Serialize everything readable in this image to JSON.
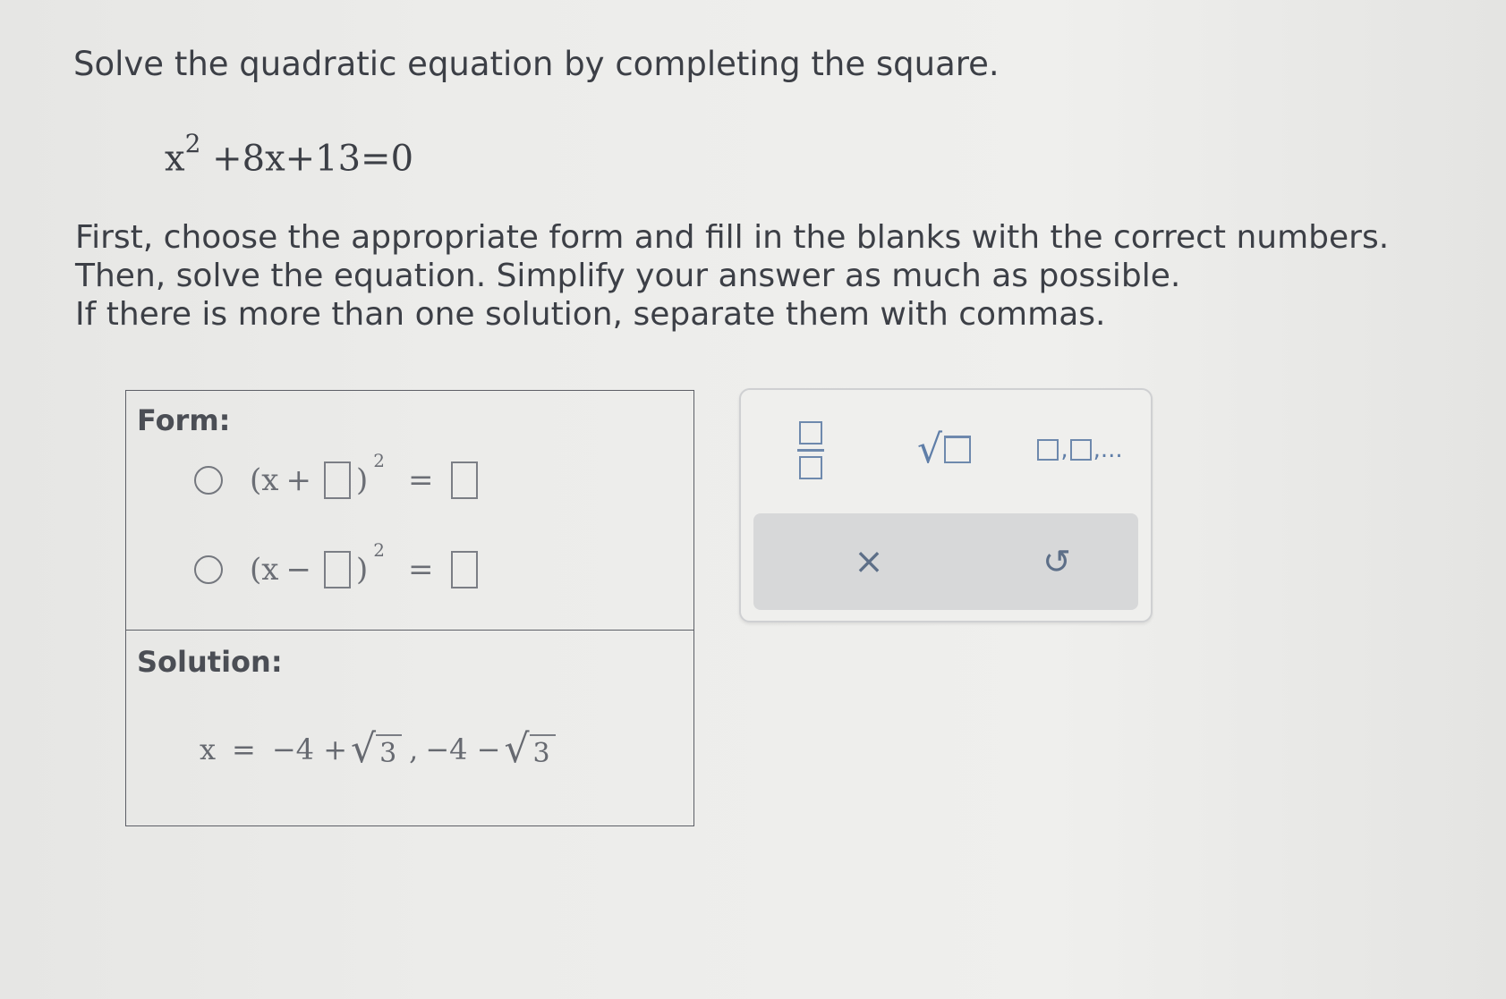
{
  "question": {
    "title": "Solve the quadratic equation by completing the square.",
    "equation": {
      "base": "x",
      "exponent": "2",
      "rest": "+8x+13=0"
    },
    "instructions": [
      "First, choose the appropriate form and fill in the blanks with the correct numbers.",
      "Then, solve the equation. Simplify your answer as much as possible.",
      "If there is more than one solution, separate them with commas."
    ]
  },
  "answer_panel": {
    "form_label": "Form:",
    "options": [
      {
        "open": "(x",
        "sign": "+",
        "exponent": "2",
        "equals": "="
      },
      {
        "open": "(x",
        "sign": "−",
        "exponent": "2",
        "equals": "="
      }
    ],
    "solution_label": "Solution:",
    "solution": {
      "lhs": "x",
      "equals": "=",
      "first_term": "−4 +",
      "first_radicand": "3",
      "separator": ",",
      "second_term": "−4 −",
      "second_radicand": "3"
    }
  },
  "toolbar": {
    "list_suffix": ",...",
    "clear_symbol": "×",
    "undo_symbol": "↺"
  }
}
